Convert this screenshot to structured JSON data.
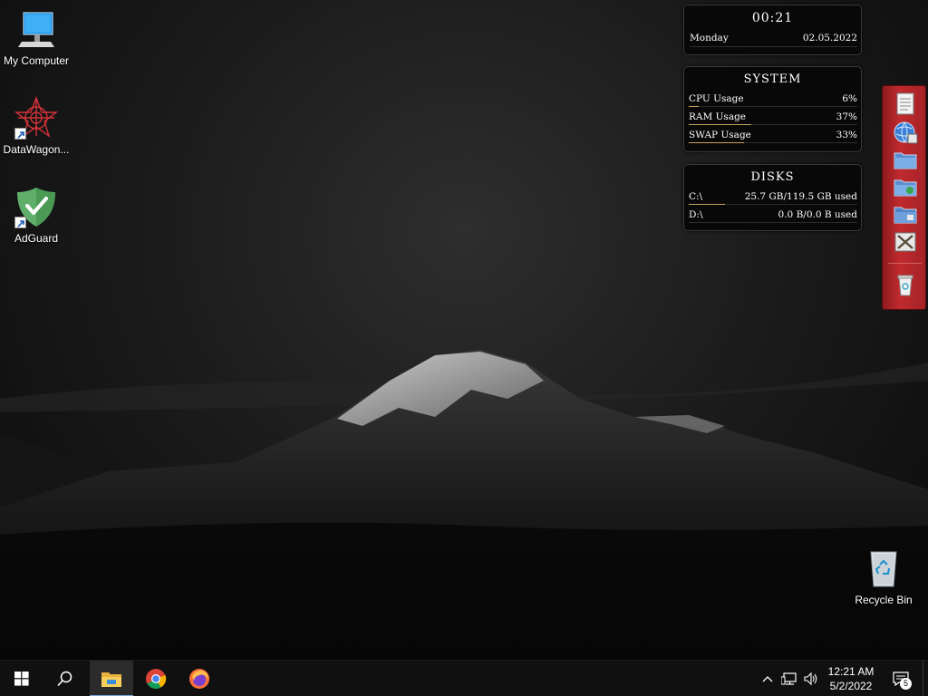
{
  "desktop_icons": [
    {
      "label": "My Computer",
      "icon": "computer-icon"
    },
    {
      "label": "DataWagon...",
      "icon": "datawagon-icon"
    },
    {
      "label": "AdGuard",
      "icon": "adguard-shield-icon"
    },
    {
      "label": "Recycle Bin",
      "icon": "recycle-bin-icon"
    }
  ],
  "clock_gadget": {
    "time": "00:21",
    "day": "Monday",
    "date": "02.05.2022"
  },
  "system_gadget": {
    "title": "SYSTEM",
    "rows": [
      {
        "label": "CPU Usage",
        "value": "6%",
        "fraction": 0.06
      },
      {
        "label": "RAM Usage",
        "value": "37%",
        "fraction": 0.37
      },
      {
        "label": "SWAP Usage",
        "value": "33%",
        "fraction": 0.33
      }
    ]
  },
  "disks_gadget": {
    "title": "DISKS",
    "rows": [
      {
        "label": "C:\\",
        "value": "25.7 GB/119.5 GB used",
        "fraction": 0.215
      },
      {
        "label": "D:\\",
        "value": "0.0 B/0.0 B used",
        "fraction": 0.0
      }
    ]
  },
  "dock_items": [
    "notepad-icon",
    "browser-globe-icon",
    "folder-icon",
    "folder-green-icon",
    "folder-blue-icon",
    "tools-icon",
    "trash-icon"
  ],
  "taskbar": {
    "apps": [
      "start-icon",
      "search-icon",
      "file-explorer-icon",
      "chrome-icon",
      "firefox-icon"
    ],
    "tray": {
      "time": "12:21 AM",
      "date": "5/2/2022",
      "notification_count": "5"
    }
  },
  "colors": {
    "accent_bar": "#c8a25a",
    "dock_red": "#c02a2e",
    "taskbar_bg": "#101010",
    "active_indicator": "#7aa7d8"
  }
}
